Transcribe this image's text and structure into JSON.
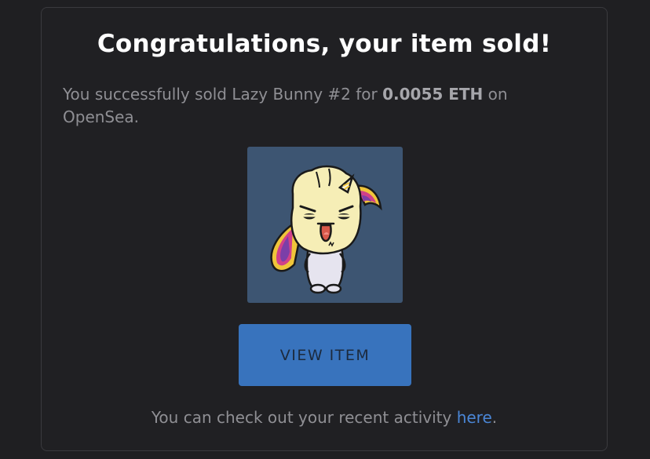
{
  "dialog": {
    "title": "Congratulations, your item sold!",
    "message_prefix": "You successfully sold Lazy Bunny #2 for ",
    "amount": "0.0055 ETH",
    "message_suffix": " on OpenSea.",
    "image_icon": "lazy-bunny-nft-image",
    "view_button_label": "VIEW ITEM",
    "footer_prefix": "You can check out your recent activity ",
    "footer_link": "here",
    "footer_suffix": "."
  },
  "colors": {
    "background": "#1f1f22",
    "card_border": "#3a3a3e",
    "image_background": "#3d5572",
    "button": "#3873bd",
    "link": "#4a86d6"
  }
}
